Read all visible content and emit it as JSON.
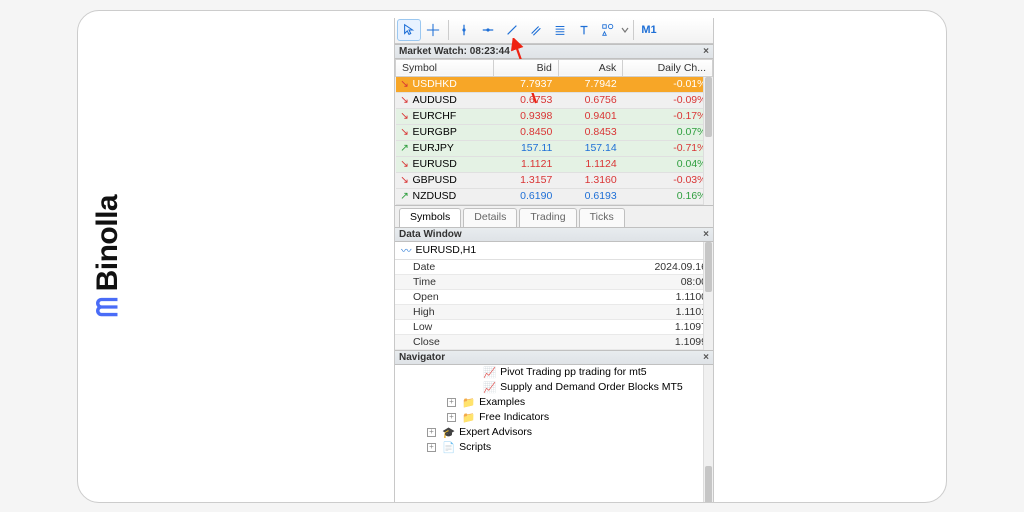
{
  "brand": "Binolla",
  "toolbar": {
    "timeframe": "M1"
  },
  "market_watch": {
    "title": "Market Watch: 08:23:44",
    "columns": [
      "Symbol",
      "Bid",
      "Ask",
      "Daily Ch..."
    ],
    "rows": [
      {
        "dir": "down",
        "sym": "USDHKD",
        "bid": "7.7937",
        "ask": "7.7942",
        "chg": "-0.01%",
        "sel": true,
        "cls": "red"
      },
      {
        "dir": "down",
        "sym": "AUDUSD",
        "bid": "0.6753",
        "ask": "0.6756",
        "chg": "-0.09%",
        "cls": "red"
      },
      {
        "dir": "down",
        "sym": "EURCHF",
        "bid": "0.9398",
        "ask": "0.9401",
        "chg": "-0.17%",
        "green": true,
        "cls": "red"
      },
      {
        "dir": "down",
        "sym": "EURGBP",
        "bid": "0.8450",
        "ask": "0.8453",
        "chg": "0.07%",
        "green": true,
        "cls": "red",
        "chgcls": "green"
      },
      {
        "dir": "up",
        "sym": "EURJPY",
        "bid": "157.11",
        "ask": "157.14",
        "chg": "-0.71%",
        "green": true,
        "cls": "blue",
        "chgcls": "red"
      },
      {
        "dir": "down",
        "sym": "EURUSD",
        "bid": "1.1121",
        "ask": "1.1124",
        "chg": "0.04%",
        "green": true,
        "cls": "red",
        "chgcls": "green"
      },
      {
        "dir": "down",
        "sym": "GBPUSD",
        "bid": "1.3157",
        "ask": "1.3160",
        "chg": "-0.03%",
        "cls": "red"
      },
      {
        "dir": "up",
        "sym": "NZDUSD",
        "bid": "0.6190",
        "ask": "0.6193",
        "chg": "0.16%",
        "cls": "blue",
        "chgcls": "green"
      }
    ],
    "tabs": [
      "Symbols",
      "Details",
      "Trading",
      "Ticks"
    ]
  },
  "data_window": {
    "title": "Data Window",
    "head": "EURUSD,H1",
    "rows": [
      {
        "lbl": "Date",
        "val": "2024.09.16"
      },
      {
        "lbl": "Time",
        "val": "08:00"
      },
      {
        "lbl": "Open",
        "val": "1.1100"
      },
      {
        "lbl": "High",
        "val": "1.1101"
      },
      {
        "lbl": "Low",
        "val": "1.1097"
      },
      {
        "lbl": "Close",
        "val": "1.1099"
      }
    ]
  },
  "navigator": {
    "title": "Navigator",
    "items": [
      {
        "lvl": 3,
        "ico": "sig",
        "txt": "Pivot Trading pp trading for mt5"
      },
      {
        "lvl": 3,
        "ico": "sig",
        "txt": "Supply and Demand Order Blocks MT5"
      },
      {
        "lvl": 2,
        "fold": true,
        "ico": "folder",
        "txt": "Examples"
      },
      {
        "lvl": 2,
        "fold": true,
        "ico": "folder",
        "txt": "Free Indicators"
      },
      {
        "lvl": 1,
        "fold": true,
        "ico": "hat",
        "txt": "Expert Advisors"
      },
      {
        "lvl": 1,
        "fold": true,
        "ico": "script",
        "txt": "Scripts"
      }
    ]
  }
}
